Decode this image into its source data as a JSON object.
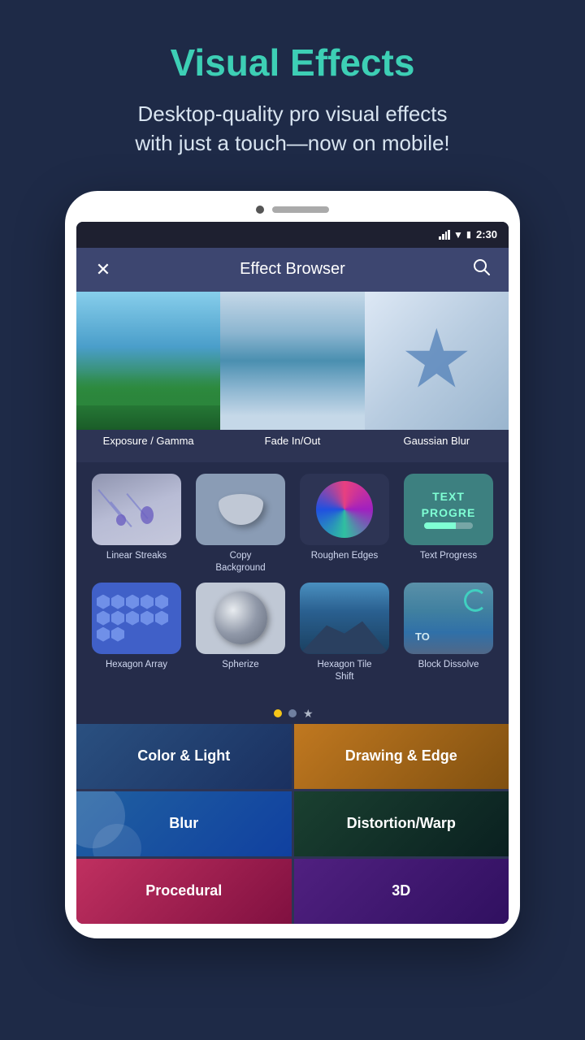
{
  "promo": {
    "title": "Visual Effects",
    "subtitle": "Desktop-quality pro visual effects\nwith just a touch—now on mobile!"
  },
  "status_bar": {
    "time": "2:30"
  },
  "header": {
    "title": "Effect Browser",
    "close_label": "✕",
    "search_label": "🔍"
  },
  "featured_effects": [
    {
      "label": "Exposure / Gamma"
    },
    {
      "label": "Fade In/Out"
    },
    {
      "label": "Gaussian Blur"
    }
  ],
  "effects_row1": [
    {
      "label": "Linear Streaks"
    },
    {
      "label": "Copy\nBackground"
    },
    {
      "label": "Roughen Edges"
    },
    {
      "label": "Text Progress"
    }
  ],
  "effects_row2": [
    {
      "label": "Hexagon Array"
    },
    {
      "label": "Spherize"
    },
    {
      "label": "Hexagon Tile\nShift"
    },
    {
      "label": "Block Dissolve"
    }
  ],
  "pagination": {
    "dots": [
      "active",
      "inactive",
      "star"
    ]
  },
  "categories": [
    {
      "label": "Color & Light",
      "style": "cat-color-light"
    },
    {
      "label": "Drawing & Edge",
      "style": "cat-color-drawing"
    },
    {
      "label": "Blur",
      "style": "cat-color-blur"
    },
    {
      "label": "Distortion/Warp",
      "style": "cat-color-distortion"
    },
    {
      "label": "Procedural",
      "style": "cat-color-procedural"
    },
    {
      "label": "3D",
      "style": "cat-color-3d"
    }
  ]
}
